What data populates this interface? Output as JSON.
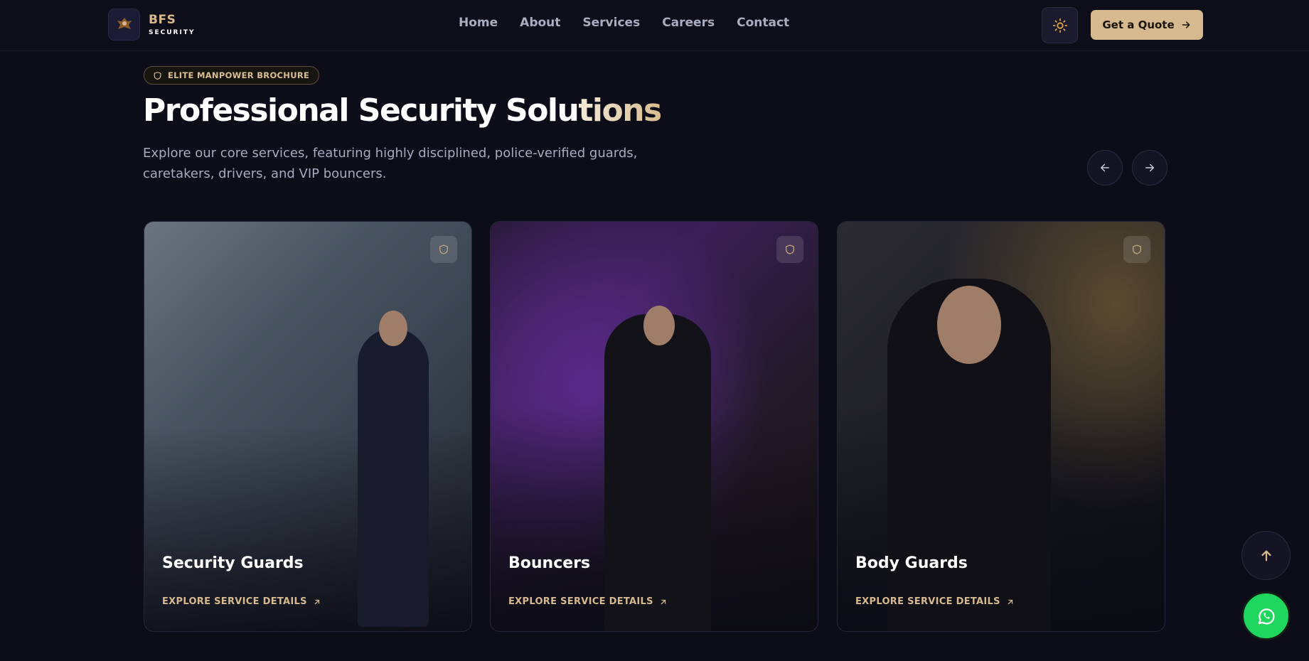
{
  "brand": {
    "name": "BFS",
    "tagline": "SECURITY",
    "badge_text": "BFS",
    "accent": "#d6b98e"
  },
  "nav": {
    "items": [
      {
        "label": "Home"
      },
      {
        "label": "About"
      },
      {
        "label": "Services"
      },
      {
        "label": "Careers"
      },
      {
        "label": "Contact"
      }
    ]
  },
  "header": {
    "theme_icon": "sun-icon",
    "quote_label": "Get a Quote",
    "quote_icon": "arrow-right-icon"
  },
  "hero": {
    "pill_label": "ELITE MANPOWER BROCHURE",
    "pill_icon": "shield-icon",
    "title_part1": "Professional Security Solu",
    "title_part2": "tions",
    "subtitle": "Explore our core services, featuring highly disciplined, police-verified guards, caretakers, drivers, and VIP bouncers.",
    "prev_icon": "arrow-left-icon",
    "next_icon": "arrow-right-icon"
  },
  "cards": [
    {
      "title": "Security Guards",
      "link": "EXPLORE SERVICE DETAILS",
      "badge_icon": "shield-icon"
    },
    {
      "title": "Bouncers",
      "link": "EXPLORE SERVICE DETAILS",
      "badge_icon": "shield-icon"
    },
    {
      "title": "Body Guards",
      "link": "EXPLORE SERVICE DETAILS",
      "badge_icon": "shield-icon"
    }
  ],
  "floating": {
    "scroll_top_icon": "arrow-up-icon",
    "whatsapp_icon": "whatsapp-icon",
    "whatsapp_color": "#1fd65f"
  }
}
